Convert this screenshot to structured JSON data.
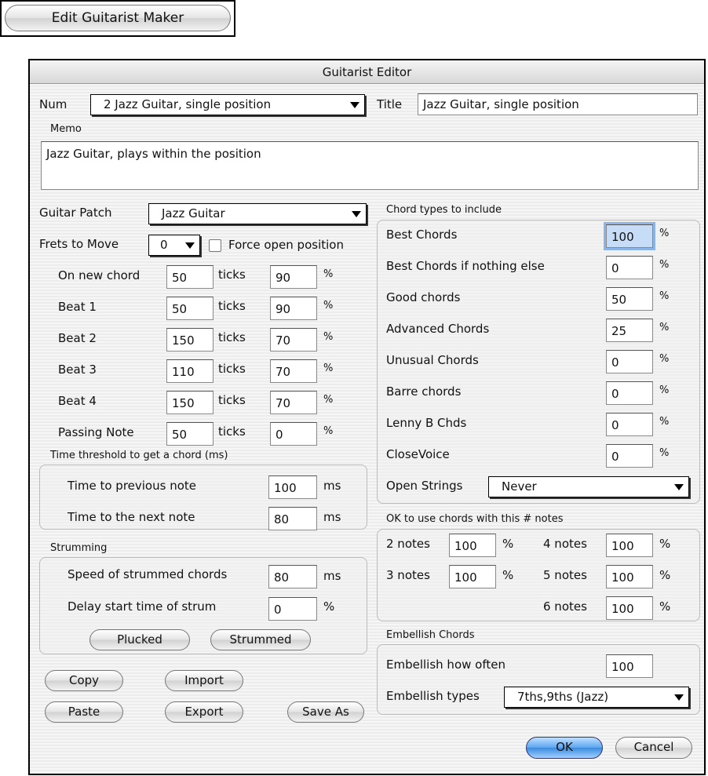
{
  "top_button": "Edit Guitarist Maker",
  "dialog": {
    "title": "Guitarist Editor",
    "num_label": "Num",
    "num_value": "2 Jazz Guitar, single position",
    "title_label": "Title",
    "title_value": "Jazz Guitar, single position",
    "memo_label": "Memo",
    "memo_value": "Jazz Guitar, plays within the position",
    "patch_label": "Guitar Patch",
    "patch_value": "Jazz Guitar",
    "frets_label": "Frets to Move",
    "frets_value": "0",
    "force_open_label": "Force open position",
    "force_open_checked": false,
    "timing_rows": [
      {
        "label": "On new chord",
        "ticks": "50",
        "pct": "90"
      },
      {
        "label": "Beat 1",
        "ticks": "50",
        "pct": "90"
      },
      {
        "label": "Beat 2",
        "ticks": "150",
        "pct": "70"
      },
      {
        "label": "Beat 3",
        "ticks": "110",
        "pct": "70"
      },
      {
        "label": "Beat 4",
        "ticks": "150",
        "pct": "70"
      },
      {
        "label": "Passing Note",
        "ticks": "50",
        "pct": "0"
      }
    ],
    "ticks_unit": "ticks",
    "pct_unit": "%",
    "ms_unit": "ms",
    "threshold": {
      "label": "Time threshold to get a chord (ms)",
      "prev_label": "Time to previous note",
      "prev_value": "100",
      "next_label": "Time to the next note",
      "next_value": "80"
    },
    "strumming": {
      "label": "Strumming",
      "speed_label": "Speed of strummed chords",
      "speed_value": "80",
      "delay_label": "Delay start time of strum",
      "delay_value": "0",
      "plucked": "Plucked",
      "strummed": "Strummed"
    },
    "buttons": {
      "copy": "Copy",
      "import": "Import",
      "paste": "Paste",
      "export": "Export",
      "save_as": "Save As",
      "ok": "OK",
      "cancel": "Cancel"
    },
    "chord_types": {
      "label": "Chord types to include",
      "rows": [
        {
          "label": "Best Chords",
          "value": "100"
        },
        {
          "label": "Best Chords if nothing else",
          "value": "0"
        },
        {
          "label": "Good chords",
          "value": "50"
        },
        {
          "label": "Advanced Chords",
          "value": "25"
        },
        {
          "label": "Unusual Chords",
          "value": "0"
        },
        {
          "label": "Barre chords",
          "value": "0"
        },
        {
          "label": "Lenny B Chds",
          "value": "0"
        },
        {
          "label": "CloseVoice",
          "value": "0"
        }
      ],
      "open_strings_label": "Open Strings",
      "open_strings_value": "Never"
    },
    "notes": {
      "label": "OK to use chords with this # notes",
      "n2_label": "2 notes",
      "n2": "100",
      "n3_label": "3 notes",
      "n3": "100",
      "n4_label": "4 notes",
      "n4": "100",
      "n5_label": "5 notes",
      "n5": "100",
      "n6_label": "6 notes",
      "n6": "100"
    },
    "embellish": {
      "label": "Embellish Chords",
      "often_label": "Embellish how often",
      "often_value": "100",
      "types_label": "Embellish types",
      "types_value": "7ths,9ths (Jazz)"
    }
  }
}
